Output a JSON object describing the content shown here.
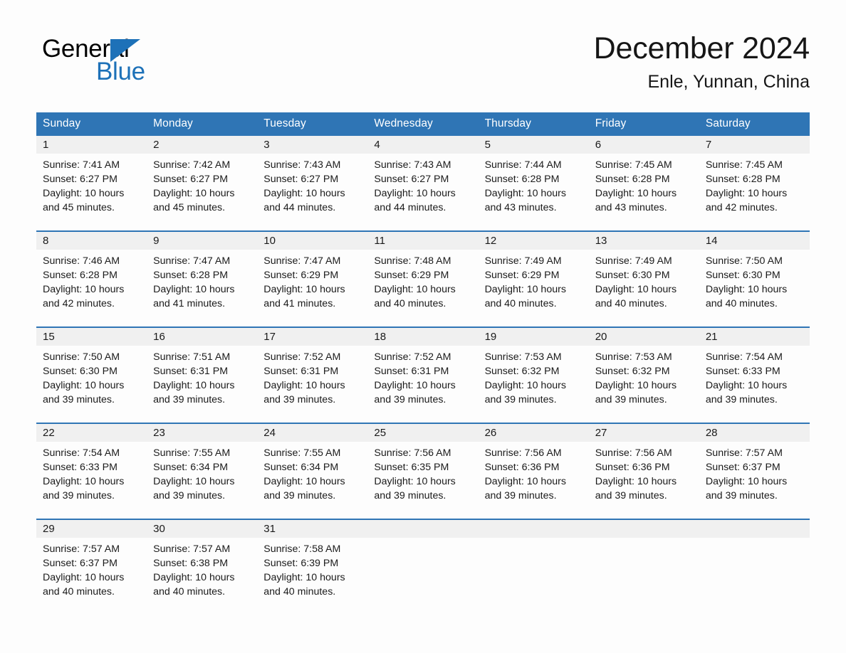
{
  "brand": {
    "name_part1": "General",
    "name_part2": "Blue",
    "logo_icon": "triangle-logo-icon"
  },
  "header": {
    "month_title": "December 2024",
    "location": "Enle, Yunnan, China"
  },
  "colors": {
    "header_blue": "#2f75b5",
    "brand_blue": "#1d71b8",
    "daynum_band": "#f0f0f0",
    "page_background": "#fdfdfd",
    "text": "#1a1a1a"
  },
  "weekday_headers": [
    "Sunday",
    "Monday",
    "Tuesday",
    "Wednesday",
    "Thursday",
    "Friday",
    "Saturday"
  ],
  "weeks": [
    [
      {
        "day": "1",
        "sunrise": "Sunrise: 7:41 AM",
        "sunset": "Sunset: 6:27 PM",
        "daylight_line1": "Daylight: 10 hours",
        "daylight_line2": "and 45 minutes."
      },
      {
        "day": "2",
        "sunrise": "Sunrise: 7:42 AM",
        "sunset": "Sunset: 6:27 PM",
        "daylight_line1": "Daylight: 10 hours",
        "daylight_line2": "and 45 minutes."
      },
      {
        "day": "3",
        "sunrise": "Sunrise: 7:43 AM",
        "sunset": "Sunset: 6:27 PM",
        "daylight_line1": "Daylight: 10 hours",
        "daylight_line2": "and 44 minutes."
      },
      {
        "day": "4",
        "sunrise": "Sunrise: 7:43 AM",
        "sunset": "Sunset: 6:27 PM",
        "daylight_line1": "Daylight: 10 hours",
        "daylight_line2": "and 44 minutes."
      },
      {
        "day": "5",
        "sunrise": "Sunrise: 7:44 AM",
        "sunset": "Sunset: 6:28 PM",
        "daylight_line1": "Daylight: 10 hours",
        "daylight_line2": "and 43 minutes."
      },
      {
        "day": "6",
        "sunrise": "Sunrise: 7:45 AM",
        "sunset": "Sunset: 6:28 PM",
        "daylight_line1": "Daylight: 10 hours",
        "daylight_line2": "and 43 minutes."
      },
      {
        "day": "7",
        "sunrise": "Sunrise: 7:45 AM",
        "sunset": "Sunset: 6:28 PM",
        "daylight_line1": "Daylight: 10 hours",
        "daylight_line2": "and 42 minutes."
      }
    ],
    [
      {
        "day": "8",
        "sunrise": "Sunrise: 7:46 AM",
        "sunset": "Sunset: 6:28 PM",
        "daylight_line1": "Daylight: 10 hours",
        "daylight_line2": "and 42 minutes."
      },
      {
        "day": "9",
        "sunrise": "Sunrise: 7:47 AM",
        "sunset": "Sunset: 6:28 PM",
        "daylight_line1": "Daylight: 10 hours",
        "daylight_line2": "and 41 minutes."
      },
      {
        "day": "10",
        "sunrise": "Sunrise: 7:47 AM",
        "sunset": "Sunset: 6:29 PM",
        "daylight_line1": "Daylight: 10 hours",
        "daylight_line2": "and 41 minutes."
      },
      {
        "day": "11",
        "sunrise": "Sunrise: 7:48 AM",
        "sunset": "Sunset: 6:29 PM",
        "daylight_line1": "Daylight: 10 hours",
        "daylight_line2": "and 40 minutes."
      },
      {
        "day": "12",
        "sunrise": "Sunrise: 7:49 AM",
        "sunset": "Sunset: 6:29 PM",
        "daylight_line1": "Daylight: 10 hours",
        "daylight_line2": "and 40 minutes."
      },
      {
        "day": "13",
        "sunrise": "Sunrise: 7:49 AM",
        "sunset": "Sunset: 6:30 PM",
        "daylight_line1": "Daylight: 10 hours",
        "daylight_line2": "and 40 minutes."
      },
      {
        "day": "14",
        "sunrise": "Sunrise: 7:50 AM",
        "sunset": "Sunset: 6:30 PM",
        "daylight_line1": "Daylight: 10 hours",
        "daylight_line2": "and 40 minutes."
      }
    ],
    [
      {
        "day": "15",
        "sunrise": "Sunrise: 7:50 AM",
        "sunset": "Sunset: 6:30 PM",
        "daylight_line1": "Daylight: 10 hours",
        "daylight_line2": "and 39 minutes."
      },
      {
        "day": "16",
        "sunrise": "Sunrise: 7:51 AM",
        "sunset": "Sunset: 6:31 PM",
        "daylight_line1": "Daylight: 10 hours",
        "daylight_line2": "and 39 minutes."
      },
      {
        "day": "17",
        "sunrise": "Sunrise: 7:52 AM",
        "sunset": "Sunset: 6:31 PM",
        "daylight_line1": "Daylight: 10 hours",
        "daylight_line2": "and 39 minutes."
      },
      {
        "day": "18",
        "sunrise": "Sunrise: 7:52 AM",
        "sunset": "Sunset: 6:31 PM",
        "daylight_line1": "Daylight: 10 hours",
        "daylight_line2": "and 39 minutes."
      },
      {
        "day": "19",
        "sunrise": "Sunrise: 7:53 AM",
        "sunset": "Sunset: 6:32 PM",
        "daylight_line1": "Daylight: 10 hours",
        "daylight_line2": "and 39 minutes."
      },
      {
        "day": "20",
        "sunrise": "Sunrise: 7:53 AM",
        "sunset": "Sunset: 6:32 PM",
        "daylight_line1": "Daylight: 10 hours",
        "daylight_line2": "and 39 minutes."
      },
      {
        "day": "21",
        "sunrise": "Sunrise: 7:54 AM",
        "sunset": "Sunset: 6:33 PM",
        "daylight_line1": "Daylight: 10 hours",
        "daylight_line2": "and 39 minutes."
      }
    ],
    [
      {
        "day": "22",
        "sunrise": "Sunrise: 7:54 AM",
        "sunset": "Sunset: 6:33 PM",
        "daylight_line1": "Daylight: 10 hours",
        "daylight_line2": "and 39 minutes."
      },
      {
        "day": "23",
        "sunrise": "Sunrise: 7:55 AM",
        "sunset": "Sunset: 6:34 PM",
        "daylight_line1": "Daylight: 10 hours",
        "daylight_line2": "and 39 minutes."
      },
      {
        "day": "24",
        "sunrise": "Sunrise: 7:55 AM",
        "sunset": "Sunset: 6:34 PM",
        "daylight_line1": "Daylight: 10 hours",
        "daylight_line2": "and 39 minutes."
      },
      {
        "day": "25",
        "sunrise": "Sunrise: 7:56 AM",
        "sunset": "Sunset: 6:35 PM",
        "daylight_line1": "Daylight: 10 hours",
        "daylight_line2": "and 39 minutes."
      },
      {
        "day": "26",
        "sunrise": "Sunrise: 7:56 AM",
        "sunset": "Sunset: 6:36 PM",
        "daylight_line1": "Daylight: 10 hours",
        "daylight_line2": "and 39 minutes."
      },
      {
        "day": "27",
        "sunrise": "Sunrise: 7:56 AM",
        "sunset": "Sunset: 6:36 PM",
        "daylight_line1": "Daylight: 10 hours",
        "daylight_line2": "and 39 minutes."
      },
      {
        "day": "28",
        "sunrise": "Sunrise: 7:57 AM",
        "sunset": "Sunset: 6:37 PM",
        "daylight_line1": "Daylight: 10 hours",
        "daylight_line2": "and 39 minutes."
      }
    ],
    [
      {
        "day": "29",
        "sunrise": "Sunrise: 7:57 AM",
        "sunset": "Sunset: 6:37 PM",
        "daylight_line1": "Daylight: 10 hours",
        "daylight_line2": "and 40 minutes."
      },
      {
        "day": "30",
        "sunrise": "Sunrise: 7:57 AM",
        "sunset": "Sunset: 6:38 PM",
        "daylight_line1": "Daylight: 10 hours",
        "daylight_line2": "and 40 minutes."
      },
      {
        "day": "31",
        "sunrise": "Sunrise: 7:58 AM",
        "sunset": "Sunset: 6:39 PM",
        "daylight_line1": "Daylight: 10 hours",
        "daylight_line2": "and 40 minutes."
      },
      {
        "day": "",
        "sunrise": "",
        "sunset": "",
        "daylight_line1": "",
        "daylight_line2": ""
      },
      {
        "day": "",
        "sunrise": "",
        "sunset": "",
        "daylight_line1": "",
        "daylight_line2": ""
      },
      {
        "day": "",
        "sunrise": "",
        "sunset": "",
        "daylight_line1": "",
        "daylight_line2": ""
      },
      {
        "day": "",
        "sunrise": "",
        "sunset": "",
        "daylight_line1": "",
        "daylight_line2": ""
      }
    ]
  ]
}
